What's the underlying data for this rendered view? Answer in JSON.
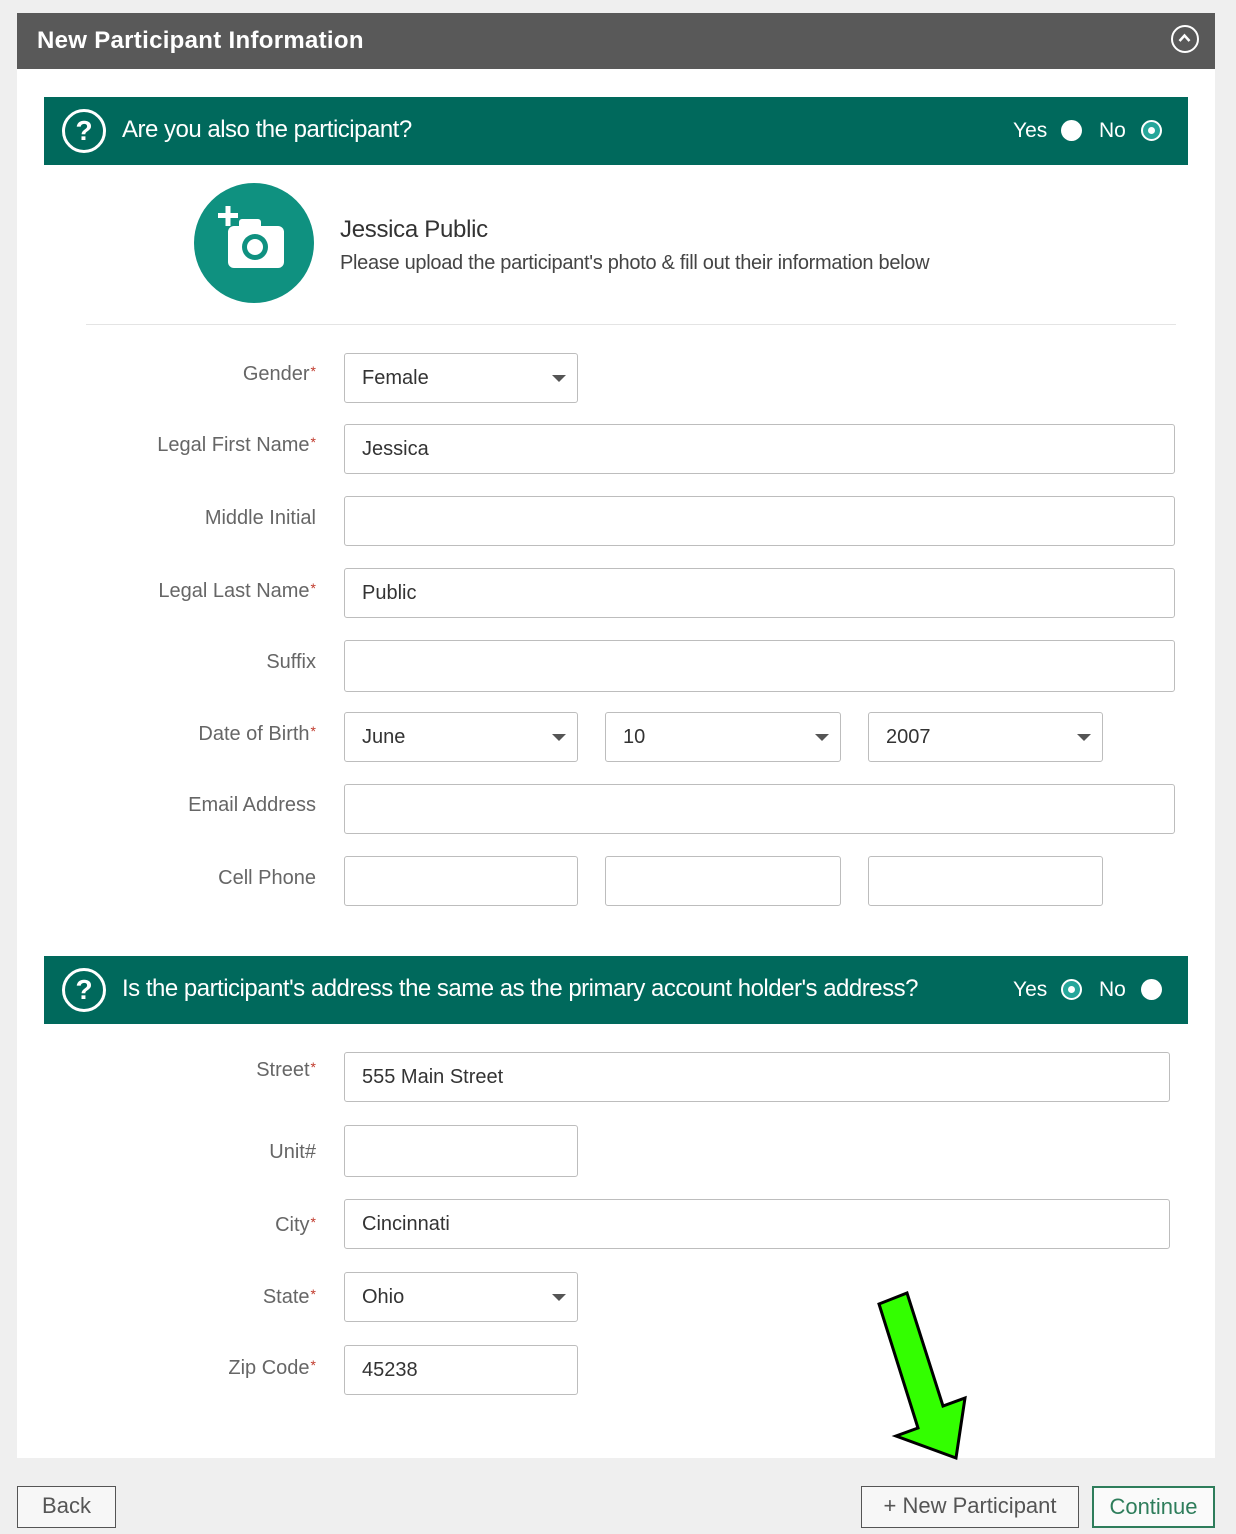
{
  "header": {
    "title": "New Participant Information",
    "collapse_icon": "chevron-up-circle-icon"
  },
  "question1": {
    "text": "Are you also the participant?",
    "yes_label": "Yes",
    "no_label": "No",
    "selected": "No"
  },
  "participant": {
    "name": "Jessica Public",
    "instructions": "Please upload the participant's photo & fill out their information below",
    "photo_icon": "add-photo-icon"
  },
  "form": {
    "gender": {
      "label": "Gender",
      "value": "Female",
      "required": "*"
    },
    "first_name": {
      "label": "Legal First Name",
      "value": "Jessica",
      "required": "*"
    },
    "middle_initial": {
      "label": "Middle Initial",
      "value": ""
    },
    "last_name": {
      "label": "Legal Last Name",
      "value": "Public",
      "required": "*"
    },
    "suffix": {
      "label": "Suffix",
      "value": ""
    },
    "dob": {
      "label": "Date of Birth",
      "required": "*",
      "month": "June",
      "day": "10",
      "year": "2007"
    },
    "email": {
      "label": "Email Address",
      "value": ""
    },
    "cell_phone": {
      "label": "Cell Phone",
      "part1": "",
      "part2": "",
      "part3": ""
    }
  },
  "question2": {
    "text": "Is the participant's address the same as the primary account holder's address?",
    "yes_label": "Yes",
    "no_label": "No",
    "selected": "Yes"
  },
  "address": {
    "street": {
      "label": "Street",
      "value": "555 Main Street",
      "required": "*"
    },
    "unit": {
      "label": "Unit#",
      "value": ""
    },
    "city": {
      "label": "City",
      "value": "Cincinnati",
      "required": "*"
    },
    "state": {
      "label": "State",
      "value": "Ohio",
      "required": "*"
    },
    "zip": {
      "label": "Zip Code",
      "value": "45238",
      "required": "*"
    }
  },
  "footer": {
    "back_label": "Back",
    "new_participant_label": "+ New Participant",
    "continue_label": "Continue"
  },
  "annotation": {
    "arrow_color": "#33ff00",
    "arrow_icon": "down-left-arrow-icon"
  },
  "colors": {
    "header_bg": "#595959",
    "question_bar_bg": "#00695c",
    "accent": "#26a69a",
    "photo_bg": "#0f9180"
  }
}
